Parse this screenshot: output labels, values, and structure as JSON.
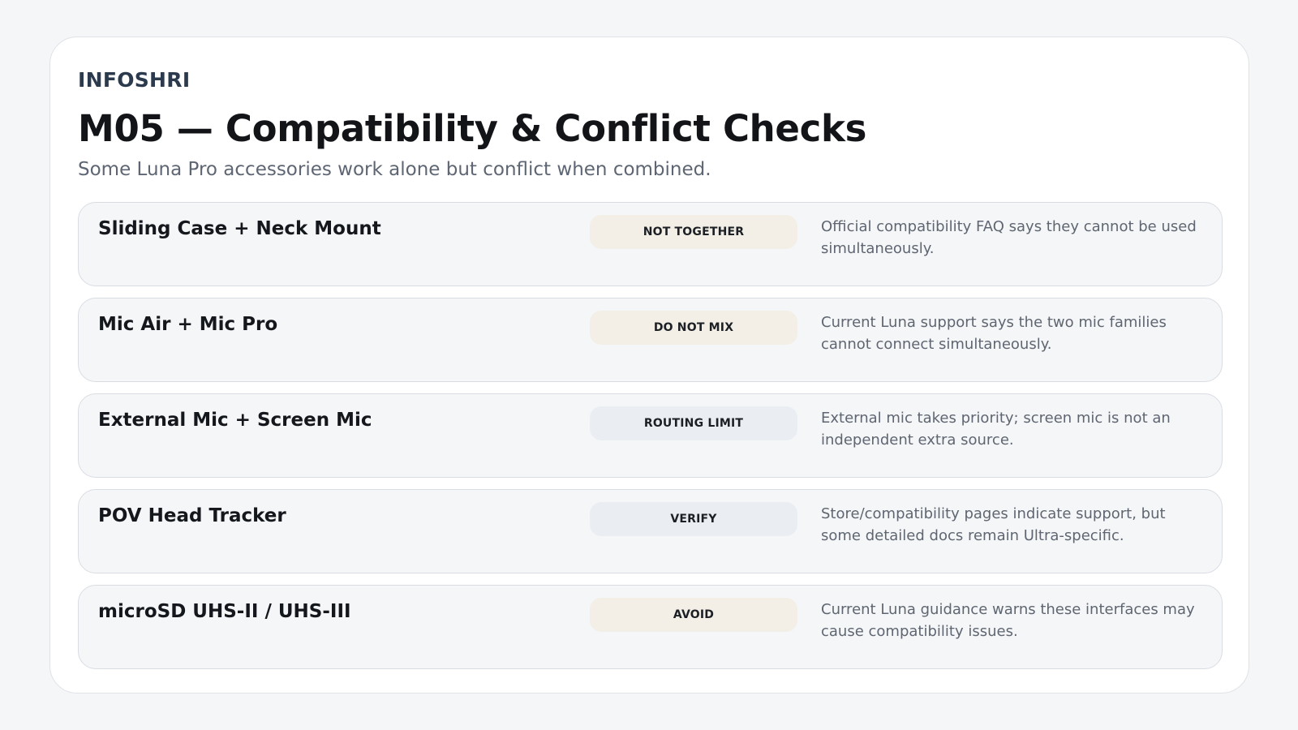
{
  "brand": "INFOSHRI",
  "title": "M05 — Compatibility & Conflict Checks",
  "subtitle": "Some Luna Pro accessories work alone but conflict when combined.",
  "colors": {
    "page_background": "#f5f6f8",
    "badge_warm": "#f3efe7",
    "badge_cool": "#eaeef3"
  },
  "rows": [
    {
      "name": "Sliding Case + Neck Mount",
      "badge": "NOT TOGETHER",
      "tone": "warm",
      "description": "Official compatibility FAQ says they cannot be used simultaneously."
    },
    {
      "name": "Mic Air + Mic Pro",
      "badge": "DO NOT MIX",
      "tone": "warm",
      "description": "Current Luna support says the two mic families cannot connect simultaneously."
    },
    {
      "name": "External Mic + Screen Mic",
      "badge": "ROUTING LIMIT",
      "tone": "cool",
      "description": "External mic takes priority; screen mic is not an independent extra source."
    },
    {
      "name": "POV Head Tracker",
      "badge": "VERIFY",
      "tone": "cool",
      "description": "Store/compatibility pages indicate support, but some detailed docs remain Ultra-specific."
    },
    {
      "name": "microSD UHS-II / UHS-III",
      "badge": "AVOID",
      "tone": "warm",
      "description": "Current Luna guidance warns these interfaces may cause compatibility issues."
    }
  ]
}
